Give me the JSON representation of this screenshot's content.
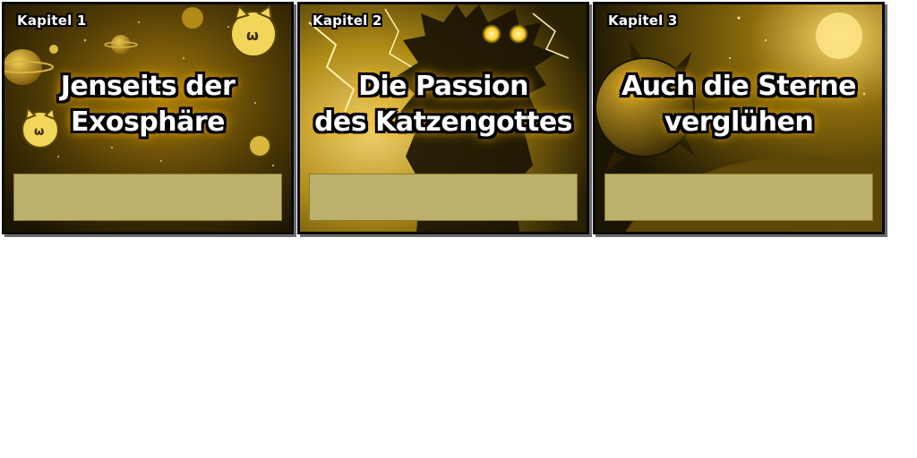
{
  "chapters": [
    {
      "label": "Kapitel 1",
      "title_line1": "Jenseits der",
      "title_line2": "Exosphäre"
    },
    {
      "label": "Kapitel 2",
      "title_line1": "Die Passion",
      "title_line2": "des Katzengottes"
    },
    {
      "label": "Kapitel 3",
      "title_line1": "Auch die Sterne",
      "title_line2": "verglühen"
    }
  ],
  "colors": {
    "panel_tint": "#c9a010",
    "info_box": "#bcb06c",
    "glow": "#ffb400"
  }
}
